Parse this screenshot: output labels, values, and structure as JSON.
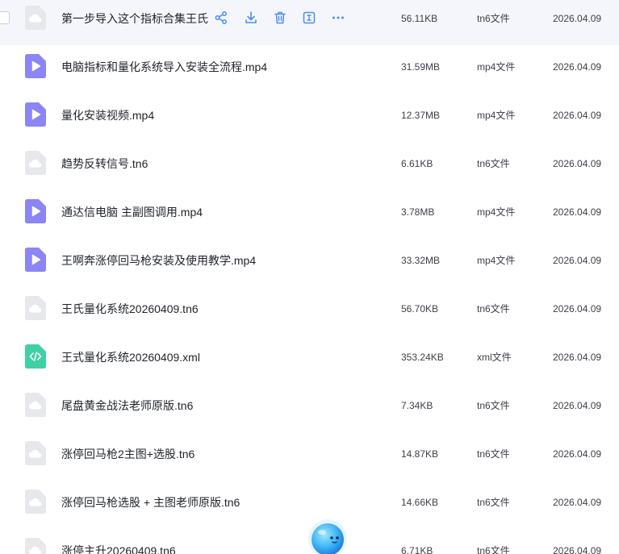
{
  "colors": {
    "tn6_icon": "#e6e8eb",
    "mp4_icon": "#8b85f6",
    "xml_icon": "#3fd1a6",
    "action_icon": "#4a8df0",
    "hover_row": "#f4f6fb"
  },
  "row_actions": {
    "icons": [
      "share-icon",
      "download-icon",
      "delete-icon",
      "rename-icon",
      "more-icon"
    ]
  },
  "files": [
    {
      "name": "第一步导入这个指标合集王氏",
      "size": "56.11KB",
      "type": "tn6文件",
      "date": "2026.04.09",
      "icon": "tn6-file-icon"
    },
    {
      "name": "电脑指标和量化系统导入安装全流程.mp4",
      "size": "31.59MB",
      "type": "mp4文件",
      "date": "2026.04.09",
      "icon": "video-file-icon"
    },
    {
      "name": "量化安装视频.mp4",
      "size": "12.37MB",
      "type": "mp4文件",
      "date": "2026.04.09",
      "icon": "video-file-icon"
    },
    {
      "name": "趋势反转信号.tn6",
      "size": "6.61KB",
      "type": "tn6文件",
      "date": "2026.04.09",
      "icon": "tn6-file-icon"
    },
    {
      "name": "通达信电脑 主副图调用.mp4",
      "size": "3.78MB",
      "type": "mp4文件",
      "date": "2026.04.09",
      "icon": "video-file-icon"
    },
    {
      "name": "王啊奔涨停回马枪安装及使用教学.mp4",
      "size": "33.32MB",
      "type": "mp4文件",
      "date": "2026.04.09",
      "icon": "video-file-icon"
    },
    {
      "name": "王氏量化系统20260409.tn6",
      "size": "56.70KB",
      "type": "tn6文件",
      "date": "2026.04.09",
      "icon": "tn6-file-icon"
    },
    {
      "name": "王式量化系统20260409.xml",
      "size": "353.24KB",
      "type": "xml文件",
      "date": "2026.04.09",
      "icon": "code-file-icon"
    },
    {
      "name": "尾盘黄金战法老师原版.tn6",
      "size": "7.34KB",
      "type": "tn6文件",
      "date": "2026.04.09",
      "icon": "tn6-file-icon"
    },
    {
      "name": "涨停回马枪2主图+选股.tn6",
      "size": "14.87KB",
      "type": "tn6文件",
      "date": "2026.04.09",
      "icon": "tn6-file-icon"
    },
    {
      "name": "涨停回马枪选股 + 主图老师原版.tn6",
      "size": "14.66KB",
      "type": "tn6文件",
      "date": "2026.04.09",
      "icon": "tn6-file-icon"
    },
    {
      "name": "涨停主升20260409.tn6",
      "size": "6.71KB",
      "type": "tn6文件",
      "date": "2026.04.09",
      "icon": "tn6-file-icon"
    }
  ]
}
